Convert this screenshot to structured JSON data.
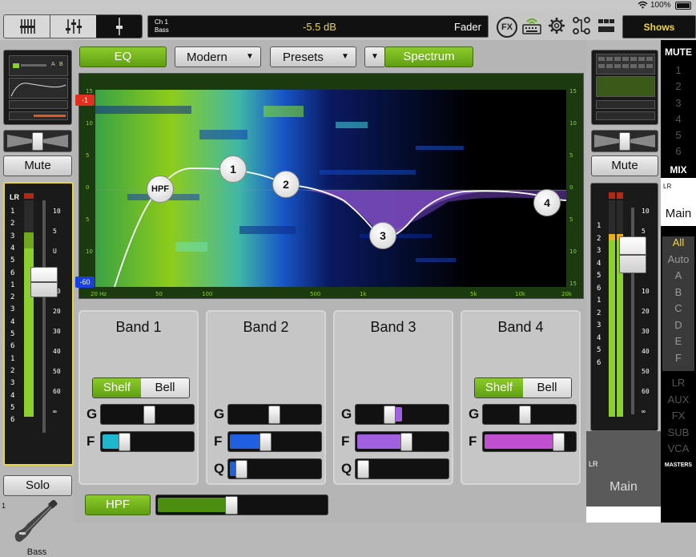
{
  "status": {
    "battery": "100%"
  },
  "topbar": {
    "channel_number": "Ch 1",
    "channel_name": "Bass",
    "level": "-5.5 dB",
    "mode": "Fader",
    "fx_label": "FX",
    "shows_button": "Shows"
  },
  "eq_toolbar": {
    "eq_button": "EQ",
    "style_select": "Modern",
    "presets_select": "Presets",
    "spectrum_button": "Spectrum"
  },
  "graph": {
    "left_top_tag": "-1",
    "left_bottom_tag": "-60",
    "y_ticks": [
      "15",
      "10",
      "5",
      "0",
      "5",
      "10",
      "15"
    ],
    "x_ticks": [
      "20 Hz",
      "50",
      "100",
      "500",
      "1k",
      "5k",
      "10k",
      "20k"
    ],
    "nodes": [
      {
        "label": "HPF"
      },
      {
        "label": "1"
      },
      {
        "label": "2"
      },
      {
        "label": "3"
      },
      {
        "label": "4"
      }
    ]
  },
  "bands": [
    {
      "title": "Band 1",
      "shelf": "Shelf",
      "bell": "Bell",
      "g": "G",
      "f": "F",
      "g_value": 0.53,
      "f_value": 0.22,
      "color": "#1fb6d0"
    },
    {
      "title": "Band 2",
      "g": "G",
      "f": "F",
      "q": "Q",
      "g_value": 0.5,
      "f_value": 0.38,
      "q_value": 0.1,
      "color": "#2060e0"
    },
    {
      "title": "Band 3",
      "g": "G",
      "f": "F",
      "q": "Q",
      "g_value": 0.36,
      "f_value": 0.55,
      "q_value": 0.02,
      "color": "#a060e0"
    },
    {
      "title": "Band 4",
      "shelf": "Shelf",
      "bell": "Bell",
      "g": "G",
      "f": "F",
      "g_value": 0.45,
      "f_value": 0.85,
      "color": "#c050d0"
    }
  ],
  "hpf": {
    "label": "HPF",
    "value": 0.45
  },
  "left_strip": {
    "mute": "Mute",
    "solo": "Solo",
    "lr": "LR",
    "channel_number": "1",
    "instrument_name": "Bass",
    "ab_a": "A",
    "ab_b": "B",
    "meter_scale": [
      "1",
      "2",
      "3",
      "4",
      "5",
      "6",
      "1",
      "2",
      "3",
      "4",
      "5",
      "6",
      "1",
      "2",
      "3",
      "4",
      "5",
      "6"
    ],
    "fader_scale": [
      "10",
      "5",
      "U",
      "5",
      "10",
      "20",
      "30",
      "40",
      "50",
      "60",
      "∞"
    ]
  },
  "right_strip": {
    "mute": "Mute",
    "meter_scale": [
      "1",
      "2",
      "3",
      "4",
      "5",
      "6",
      "1",
      "2",
      "3",
      "4",
      "5",
      "6"
    ],
    "fader_scale": [
      "10",
      "5",
      "U",
      "5",
      "10",
      "20",
      "30",
      "40",
      "50",
      "60",
      "∞"
    ],
    "lr_label": "LR",
    "main_label": "Main"
  },
  "mute_groups": {
    "header": "MUTE",
    "items": [
      "1",
      "2",
      "3",
      "4",
      "5",
      "6"
    ],
    "mix_label": "MIX",
    "lr": "LR",
    "main": "Main",
    "view_items": [
      "All",
      "Auto",
      "A",
      "B",
      "C",
      "D",
      "E",
      "F"
    ],
    "master_items": [
      "LR",
      "AUX",
      "FX",
      "SUB",
      "VCA"
    ],
    "masters_label": "MASTERS"
  },
  "colors": {
    "accent_green": "#7cbf24",
    "meter_green": "#8bd12e",
    "spectrum_purple": "#8a5cc8"
  }
}
